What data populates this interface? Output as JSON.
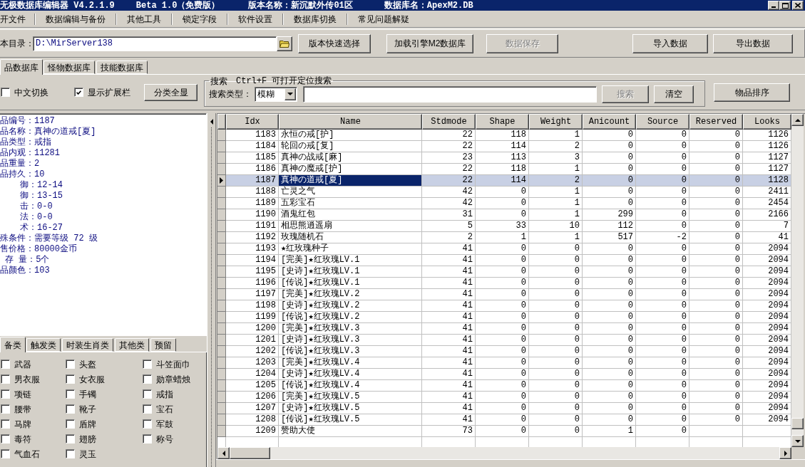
{
  "window": {
    "title": "无极数据库编辑器 V4.2.1.9",
    "edition": "Beta 1.0（免费版）",
    "version_name": "版本名称：新沉默外传01区",
    "database_name": "数据库名：ApexM2.DB"
  },
  "menu": [
    "开文件",
    "数据编辑与备份",
    "其他工具",
    "锁定字段",
    "软件设置",
    "数据库切换",
    "常见问题解疑"
  ],
  "toolbar": {
    "path_label": "本目录：",
    "path_value": "D:\\MirServer138",
    "buttons": [
      {
        "label": "版本快速选择",
        "disabled": false
      },
      {
        "label": "加载引擎M2数据库",
        "disabled": false
      },
      {
        "label": "数据保存",
        "disabled": true
      }
    ],
    "io_buttons": [
      {
        "label": "导入数据",
        "disabled": false
      },
      {
        "label": "导出数据",
        "disabled": false
      }
    ]
  },
  "db_tabs": [
    {
      "label": "品数据库",
      "selected": true
    },
    {
      "label": "怪物数据库",
      "selected": false
    },
    {
      "label": "技能数据库",
      "selected": false
    }
  ],
  "options": {
    "checkboxes": [
      {
        "label": "中文切换",
        "checked": false
      },
      {
        "label": "显示扩展栏",
        "checked": true
      }
    ],
    "show_all_button": "分类全显"
  },
  "search": {
    "legend": "搜索",
    "hint": "Ctrl+F 可打开定位搜索",
    "type_label": "搜索类型：",
    "type_value": "模糊",
    "buttons": [
      {
        "label": "搜索",
        "disabled": true
      },
      {
        "label": "清空",
        "disabled": false
      }
    ]
  },
  "sort_button": "物品排序",
  "item_details": [
    {
      "text": "品编号：1187",
      "kind": "main"
    },
    {
      "text": "品名称：真神の道戒[夏]",
      "kind": "main"
    },
    {
      "text": "品类型：戒指",
      "kind": "main"
    },
    {
      "text": "品内观：11281",
      "kind": "main"
    },
    {
      "text": "品重量：2",
      "kind": "main"
    },
    {
      "text": "品持久：10",
      "kind": "main"
    },
    {
      "text": "御：12-14",
      "kind": "sub"
    },
    {
      "text": "御：13-15",
      "kind": "sub"
    },
    {
      "text": "击：0-0",
      "kind": "sub"
    },
    {
      "text": "法：0-0",
      "kind": "sub"
    },
    {
      "text": "术：16-27",
      "kind": "sub"
    },
    {
      "text": "殊条件：需要等级 72 级",
      "kind": "main"
    },
    {
      "text": "售价格：80000金币",
      "kind": "main"
    },
    {
      "text": "存 量：5个",
      "kind": "mid"
    },
    {
      "text": "品颜色：103",
      "kind": "main"
    }
  ],
  "category_tabs": [
    {
      "label": "备类",
      "selected": true
    },
    {
      "label": "触发类",
      "selected": false
    },
    {
      "label": "时装生肖类",
      "selected": false
    },
    {
      "label": "其他类",
      "selected": false
    },
    {
      "label": "预留",
      "selected": false
    }
  ],
  "categories": [
    {
      "label": "武器",
      "checked": false
    },
    {
      "label": "头盔",
      "checked": false
    },
    {
      "label": "斗笠面巾",
      "checked": false
    },
    {
      "label": "男衣服",
      "checked": false
    },
    {
      "label": "女衣服",
      "checked": false
    },
    {
      "label": "勋章蜡烛",
      "checked": false
    },
    {
      "label": "项链",
      "checked": false
    },
    {
      "label": "手镯",
      "checked": false
    },
    {
      "label": "戒指",
      "checked": false
    },
    {
      "label": "腰带",
      "checked": false
    },
    {
      "label": "靴子",
      "checked": false
    },
    {
      "label": "宝石",
      "checked": false
    },
    {
      "label": "马牌",
      "checked": false
    },
    {
      "label": "盾牌",
      "checked": false
    },
    {
      "label": "军鼓",
      "checked": false
    },
    {
      "label": "毒符",
      "checked": false
    },
    {
      "label": "翅膀",
      "checked": false
    },
    {
      "label": "称号",
      "checked": false
    },
    {
      "label": "气血石",
      "checked": false
    },
    {
      "label": "灵玉",
      "checked": false
    }
  ],
  "table": {
    "columns": [
      {
        "label": "Idx",
        "focused": false
      },
      {
        "label": "Name",
        "focused": true
      },
      {
        "label": "Stdmode",
        "focused": false
      },
      {
        "label": "Shape",
        "focused": false
      },
      {
        "label": "Weight",
        "focused": false
      },
      {
        "label": "Anicount",
        "focused": false
      },
      {
        "label": "Source",
        "focused": false
      },
      {
        "label": "Reserved",
        "focused": false
      },
      {
        "label": "Looks",
        "focused": false
      }
    ],
    "rows": [
      {
        "cells": [
          "1183",
          "永恒の戒[护]",
          "22",
          "118",
          "1",
          "0",
          "0",
          "0",
          "1126"
        ],
        "selected": false
      },
      {
        "cells": [
          "1184",
          "轮回の戒[复]",
          "22",
          "114",
          "2",
          "0",
          "0",
          "0",
          "1126"
        ],
        "selected": false
      },
      {
        "cells": [
          "1185",
          "真神の战戒[麻]",
          "23",
          "113",
          "3",
          "0",
          "0",
          "0",
          "1127"
        ],
        "selected": false
      },
      {
        "cells": [
          "1186",
          "真神の魔戒[护]",
          "22",
          "118",
          "1",
          "0",
          "0",
          "0",
          "1127"
        ],
        "selected": false
      },
      {
        "cells": [
          "1187",
          "真神の道戒[夏]",
          "22",
          "114",
          "2",
          "0",
          "0",
          "0",
          "1128"
        ],
        "selected": true
      },
      {
        "cells": [
          "1188",
          "亡灵之气",
          "42",
          "0",
          "1",
          "0",
          "0",
          "0",
          "2411"
        ],
        "selected": false
      },
      {
        "cells": [
          "1189",
          "五彩宝石",
          "42",
          "0",
          "1",
          "0",
          "0",
          "0",
          "2454"
        ],
        "selected": false
      },
      {
        "cells": [
          "1190",
          "酒鬼红包",
          "31",
          "0",
          "1",
          "299",
          "0",
          "0",
          "2166"
        ],
        "selected": false
      },
      {
        "cells": [
          "1191",
          "相思熊逍遥扇",
          "5",
          "33",
          "10",
          "112",
          "0",
          "0",
          "7"
        ],
        "selected": false
      },
      {
        "cells": [
          "1192",
          "玫瑰随机石",
          "2",
          "1",
          "1",
          "517",
          "-2",
          "0",
          "41"
        ],
        "selected": false
      },
      {
        "cells": [
          "1193",
          "★红玫瑰种子",
          "41",
          "0",
          "0",
          "0",
          "0",
          "0",
          "2094"
        ],
        "selected": false
      },
      {
        "cells": [
          "1194",
          "[完美]★红玫瑰LV.1",
          "41",
          "0",
          "0",
          "0",
          "0",
          "0",
          "2094"
        ],
        "selected": false
      },
      {
        "cells": [
          "1195",
          "[史诗]★红玫瑰LV.1",
          "41",
          "0",
          "0",
          "0",
          "0",
          "0",
          "2094"
        ],
        "selected": false
      },
      {
        "cells": [
          "1196",
          "[传说]★红玫瑰LV.1",
          "41",
          "0",
          "0",
          "0",
          "0",
          "0",
          "2094"
        ],
        "selected": false
      },
      {
        "cells": [
          "1197",
          "[完美]★红玫瑰LV.2",
          "41",
          "0",
          "0",
          "0",
          "0",
          "0",
          "2094"
        ],
        "selected": false
      },
      {
        "cells": [
          "1198",
          "[史诗]★红玫瑰LV.2",
          "41",
          "0",
          "0",
          "0",
          "0",
          "0",
          "2094"
        ],
        "selected": false
      },
      {
        "cells": [
          "1199",
          "[传说]★红玫瑰LV.2",
          "41",
          "0",
          "0",
          "0",
          "0",
          "0",
          "2094"
        ],
        "selected": false
      },
      {
        "cells": [
          "1200",
          "[完美]★红玫瑰LV.3",
          "41",
          "0",
          "0",
          "0",
          "0",
          "0",
          "2094"
        ],
        "selected": false
      },
      {
        "cells": [
          "1201",
          "[史诗]★红玫瑰LV.3",
          "41",
          "0",
          "0",
          "0",
          "0",
          "0",
          "2094"
        ],
        "selected": false
      },
      {
        "cells": [
          "1202",
          "[传说]★红玫瑰LV.3",
          "41",
          "0",
          "0",
          "0",
          "0",
          "0",
          "2094"
        ],
        "selected": false
      },
      {
        "cells": [
          "1203",
          "[完美]★红玫瑰LV.4",
          "41",
          "0",
          "0",
          "0",
          "0",
          "0",
          "2094"
        ],
        "selected": false
      },
      {
        "cells": [
          "1204",
          "[史诗]★红玫瑰LV.4",
          "41",
          "0",
          "0",
          "0",
          "0",
          "0",
          "2094"
        ],
        "selected": false
      },
      {
        "cells": [
          "1205",
          "[传说]★红玫瑰LV.4",
          "41",
          "0",
          "0",
          "0",
          "0",
          "0",
          "2094"
        ],
        "selected": false
      },
      {
        "cells": [
          "1206",
          "[完美]★红玫瑰LV.5",
          "41",
          "0",
          "0",
          "0",
          "0",
          "0",
          "2094"
        ],
        "selected": false
      },
      {
        "cells": [
          "1207",
          "[史诗]★红玫瑰LV.5",
          "41",
          "0",
          "0",
          "0",
          "0",
          "0",
          "2094"
        ],
        "selected": false
      },
      {
        "cells": [
          "1208",
          "[传说]★红玫瑰LV.5",
          "41",
          "0",
          "0",
          "0",
          "0",
          "0",
          "2094"
        ],
        "selected": false
      },
      {
        "cells": [
          "1209",
          "赞助大使",
          "73",
          "0",
          "0",
          "1",
          "0"
        ],
        "selected": false
      }
    ]
  }
}
